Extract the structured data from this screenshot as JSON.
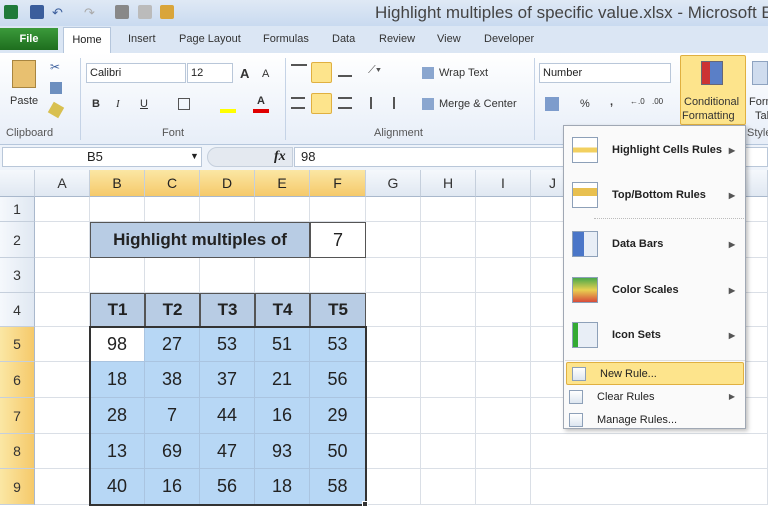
{
  "window": {
    "title": "Highlight multiples of specific value.xlsx - Microsoft Ex"
  },
  "tabs": [
    "File",
    "Home",
    "Insert",
    "Page Layout",
    "Formulas",
    "Data",
    "Review",
    "View",
    "Developer"
  ],
  "ribbon": {
    "clipboard": {
      "paste": "Paste",
      "label": "Clipboard"
    },
    "font": {
      "name": "Calibri",
      "size": "12",
      "bold": "B",
      "italic": "I",
      "underline": "U",
      "label": "Font"
    },
    "alignment": {
      "wrap": "Wrap Text",
      "merge": "Merge & Center",
      "label": "Alignment"
    },
    "number": {
      "format": "Number",
      "percent": "%",
      "comma": ","
    },
    "styles": {
      "conditional_line1": "Conditional",
      "conditional_line2": "Formatting",
      "format_table_1": "Form",
      "format_table_2": "Tal",
      "label": "Style"
    }
  },
  "formula_bar": {
    "name_box": "B5",
    "fx": "fx",
    "value": "98"
  },
  "columns": [
    "A",
    "B",
    "C",
    "D",
    "E",
    "F",
    "G",
    "H",
    "I",
    "J"
  ],
  "rows": [
    "1",
    "2",
    "3",
    "4",
    "5",
    "6",
    "7",
    "8",
    "9"
  ],
  "sheet": {
    "label": "Highlight multiples of",
    "value": "7",
    "headers": [
      "T1",
      "T2",
      "T3",
      "T4",
      "T5"
    ],
    "data": [
      [
        "98",
        "27",
        "53",
        "51",
        "53"
      ],
      [
        "18",
        "38",
        "37",
        "21",
        "56"
      ],
      [
        "28",
        "7",
        "44",
        "16",
        "29"
      ],
      [
        "13",
        "69",
        "47",
        "93",
        "50"
      ],
      [
        "40",
        "16",
        "56",
        "18",
        "58"
      ]
    ]
  },
  "menu": {
    "items": [
      "Highlight Cells Rules",
      "Top/Bottom Rules",
      "Data Bars",
      "Color Scales",
      "Icon Sets"
    ],
    "new_rule": "New Rule...",
    "clear_rules": "Clear Rules",
    "manage_rules": "Manage Rules..."
  }
}
